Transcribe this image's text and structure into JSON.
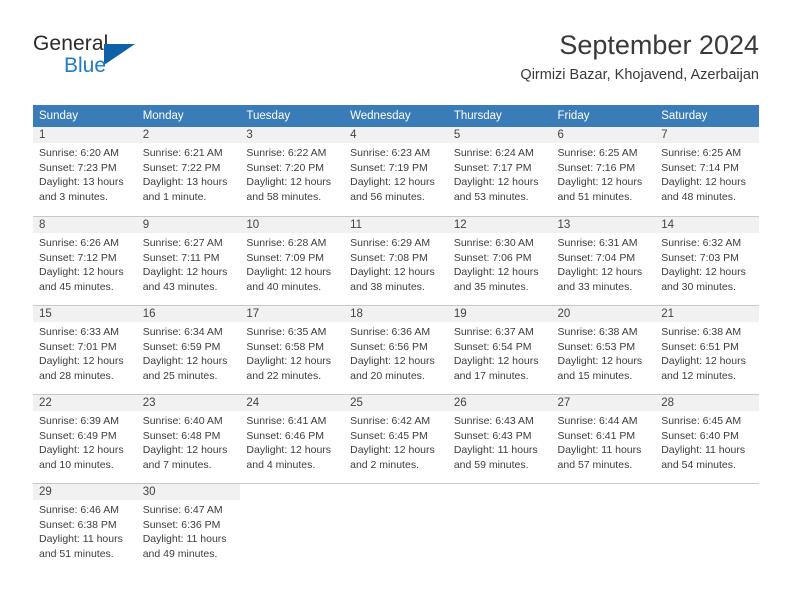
{
  "brand": {
    "name_top": "General",
    "name_bottom": "Blue",
    "color_dark": "#2b2b2b",
    "color_blue": "#1f7dc4",
    "triangle_color": "#1060a8"
  },
  "header": {
    "title": "September 2024",
    "subtitle": "Qirmizi Bazar, Khojavend, Azerbaijan"
  },
  "theme": {
    "header_bg": "#3a7cb8",
    "header_text": "#ffffff",
    "daynum_bg": "#f1f1f1",
    "grid_line": "#c8c8c8",
    "body_text": "#3d3d3d"
  },
  "weekdays": [
    "Sunday",
    "Monday",
    "Tuesday",
    "Wednesday",
    "Thursday",
    "Friday",
    "Saturday"
  ],
  "weeks": [
    [
      {
        "day": "1",
        "sunrise": "Sunrise: 6:20 AM",
        "sunset": "Sunset: 7:23 PM",
        "daylight1": "Daylight: 13 hours",
        "daylight2": "and 3 minutes."
      },
      {
        "day": "2",
        "sunrise": "Sunrise: 6:21 AM",
        "sunset": "Sunset: 7:22 PM",
        "daylight1": "Daylight: 13 hours",
        "daylight2": "and 1 minute."
      },
      {
        "day": "3",
        "sunrise": "Sunrise: 6:22 AM",
        "sunset": "Sunset: 7:20 PM",
        "daylight1": "Daylight: 12 hours",
        "daylight2": "and 58 minutes."
      },
      {
        "day": "4",
        "sunrise": "Sunrise: 6:23 AM",
        "sunset": "Sunset: 7:19 PM",
        "daylight1": "Daylight: 12 hours",
        "daylight2": "and 56 minutes."
      },
      {
        "day": "5",
        "sunrise": "Sunrise: 6:24 AM",
        "sunset": "Sunset: 7:17 PM",
        "daylight1": "Daylight: 12 hours",
        "daylight2": "and 53 minutes."
      },
      {
        "day": "6",
        "sunrise": "Sunrise: 6:25 AM",
        "sunset": "Sunset: 7:16 PM",
        "daylight1": "Daylight: 12 hours",
        "daylight2": "and 51 minutes."
      },
      {
        "day": "7",
        "sunrise": "Sunrise: 6:25 AM",
        "sunset": "Sunset: 7:14 PM",
        "daylight1": "Daylight: 12 hours",
        "daylight2": "and 48 minutes."
      }
    ],
    [
      {
        "day": "8",
        "sunrise": "Sunrise: 6:26 AM",
        "sunset": "Sunset: 7:12 PM",
        "daylight1": "Daylight: 12 hours",
        "daylight2": "and 45 minutes."
      },
      {
        "day": "9",
        "sunrise": "Sunrise: 6:27 AM",
        "sunset": "Sunset: 7:11 PM",
        "daylight1": "Daylight: 12 hours",
        "daylight2": "and 43 minutes."
      },
      {
        "day": "10",
        "sunrise": "Sunrise: 6:28 AM",
        "sunset": "Sunset: 7:09 PM",
        "daylight1": "Daylight: 12 hours",
        "daylight2": "and 40 minutes."
      },
      {
        "day": "11",
        "sunrise": "Sunrise: 6:29 AM",
        "sunset": "Sunset: 7:08 PM",
        "daylight1": "Daylight: 12 hours",
        "daylight2": "and 38 minutes."
      },
      {
        "day": "12",
        "sunrise": "Sunrise: 6:30 AM",
        "sunset": "Sunset: 7:06 PM",
        "daylight1": "Daylight: 12 hours",
        "daylight2": "and 35 minutes."
      },
      {
        "day": "13",
        "sunrise": "Sunrise: 6:31 AM",
        "sunset": "Sunset: 7:04 PM",
        "daylight1": "Daylight: 12 hours",
        "daylight2": "and 33 minutes."
      },
      {
        "day": "14",
        "sunrise": "Sunrise: 6:32 AM",
        "sunset": "Sunset: 7:03 PM",
        "daylight1": "Daylight: 12 hours",
        "daylight2": "and 30 minutes."
      }
    ],
    [
      {
        "day": "15",
        "sunrise": "Sunrise: 6:33 AM",
        "sunset": "Sunset: 7:01 PM",
        "daylight1": "Daylight: 12 hours",
        "daylight2": "and 28 minutes."
      },
      {
        "day": "16",
        "sunrise": "Sunrise: 6:34 AM",
        "sunset": "Sunset: 6:59 PM",
        "daylight1": "Daylight: 12 hours",
        "daylight2": "and 25 minutes."
      },
      {
        "day": "17",
        "sunrise": "Sunrise: 6:35 AM",
        "sunset": "Sunset: 6:58 PM",
        "daylight1": "Daylight: 12 hours",
        "daylight2": "and 22 minutes."
      },
      {
        "day": "18",
        "sunrise": "Sunrise: 6:36 AM",
        "sunset": "Sunset: 6:56 PM",
        "daylight1": "Daylight: 12 hours",
        "daylight2": "and 20 minutes."
      },
      {
        "day": "19",
        "sunrise": "Sunrise: 6:37 AM",
        "sunset": "Sunset: 6:54 PM",
        "daylight1": "Daylight: 12 hours",
        "daylight2": "and 17 minutes."
      },
      {
        "day": "20",
        "sunrise": "Sunrise: 6:38 AM",
        "sunset": "Sunset: 6:53 PM",
        "daylight1": "Daylight: 12 hours",
        "daylight2": "and 15 minutes."
      },
      {
        "day": "21",
        "sunrise": "Sunrise: 6:38 AM",
        "sunset": "Sunset: 6:51 PM",
        "daylight1": "Daylight: 12 hours",
        "daylight2": "and 12 minutes."
      }
    ],
    [
      {
        "day": "22",
        "sunrise": "Sunrise: 6:39 AM",
        "sunset": "Sunset: 6:49 PM",
        "daylight1": "Daylight: 12 hours",
        "daylight2": "and 10 minutes."
      },
      {
        "day": "23",
        "sunrise": "Sunrise: 6:40 AM",
        "sunset": "Sunset: 6:48 PM",
        "daylight1": "Daylight: 12 hours",
        "daylight2": "and 7 minutes."
      },
      {
        "day": "24",
        "sunrise": "Sunrise: 6:41 AM",
        "sunset": "Sunset: 6:46 PM",
        "daylight1": "Daylight: 12 hours",
        "daylight2": "and 4 minutes."
      },
      {
        "day": "25",
        "sunrise": "Sunrise: 6:42 AM",
        "sunset": "Sunset: 6:45 PM",
        "daylight1": "Daylight: 12 hours",
        "daylight2": "and 2 minutes."
      },
      {
        "day": "26",
        "sunrise": "Sunrise: 6:43 AM",
        "sunset": "Sunset: 6:43 PM",
        "daylight1": "Daylight: 11 hours",
        "daylight2": "and 59 minutes."
      },
      {
        "day": "27",
        "sunrise": "Sunrise: 6:44 AM",
        "sunset": "Sunset: 6:41 PM",
        "daylight1": "Daylight: 11 hours",
        "daylight2": "and 57 minutes."
      },
      {
        "day": "28",
        "sunrise": "Sunrise: 6:45 AM",
        "sunset": "Sunset: 6:40 PM",
        "daylight1": "Daylight: 11 hours",
        "daylight2": "and 54 minutes."
      }
    ],
    [
      {
        "day": "29",
        "sunrise": "Sunrise: 6:46 AM",
        "sunset": "Sunset: 6:38 PM",
        "daylight1": "Daylight: 11 hours",
        "daylight2": "and 51 minutes."
      },
      {
        "day": "30",
        "sunrise": "Sunrise: 6:47 AM",
        "sunset": "Sunset: 6:36 PM",
        "daylight1": "Daylight: 11 hours",
        "daylight2": "and 49 minutes."
      },
      {
        "day": "",
        "sunrise": "",
        "sunset": "",
        "daylight1": "",
        "daylight2": ""
      },
      {
        "day": "",
        "sunrise": "",
        "sunset": "",
        "daylight1": "",
        "daylight2": ""
      },
      {
        "day": "",
        "sunrise": "",
        "sunset": "",
        "daylight1": "",
        "daylight2": ""
      },
      {
        "day": "",
        "sunrise": "",
        "sunset": "",
        "daylight1": "",
        "daylight2": ""
      },
      {
        "day": "",
        "sunrise": "",
        "sunset": "",
        "daylight1": "",
        "daylight2": ""
      }
    ]
  ]
}
